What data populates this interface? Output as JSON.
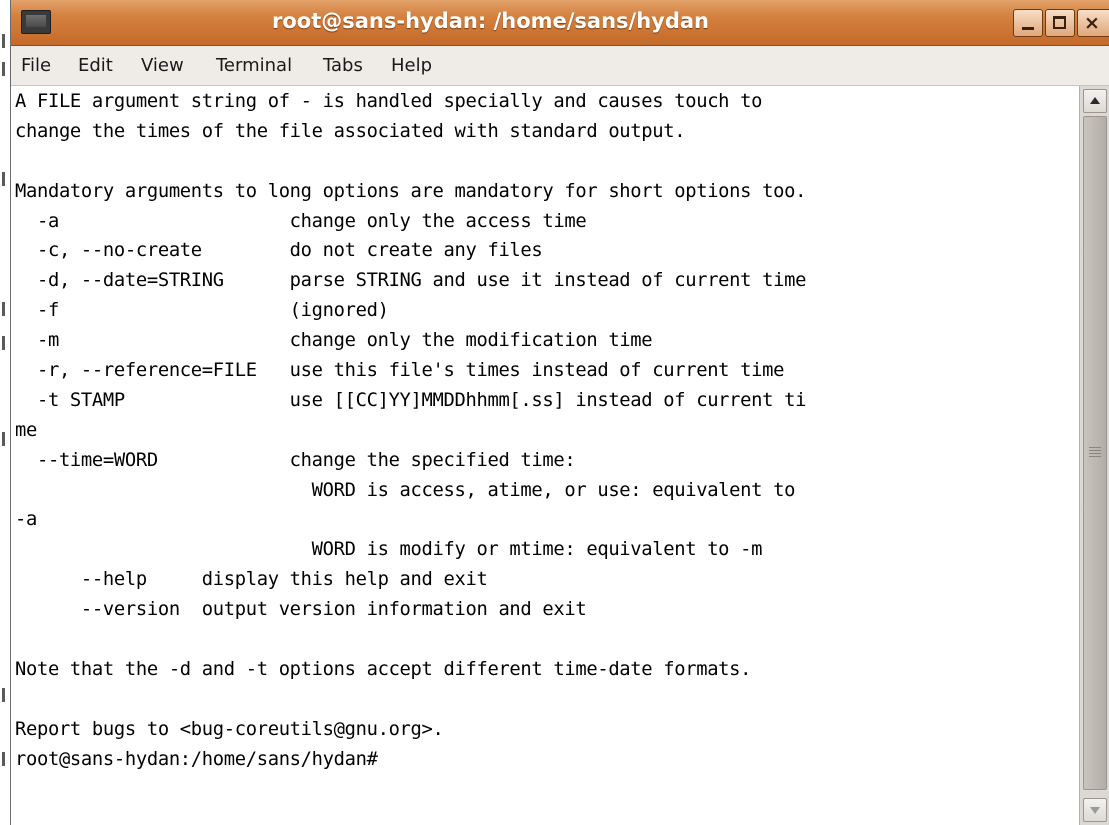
{
  "window": {
    "title": "root@sans-hydan: /home/sans/hydan",
    "icon": "terminal-icon"
  },
  "controls": {
    "minimize": "minimize-icon",
    "maximize": "maximize-icon",
    "close": "close-icon",
    "close_glyph": "×"
  },
  "menu": {
    "items": [
      {
        "label": "File",
        "x": 0
      },
      {
        "label": "Edit"
      },
      {
        "label": "View"
      },
      {
        "label": "Terminal"
      },
      {
        "label": "Tabs"
      },
      {
        "label": "Help"
      }
    ]
  },
  "terminal": {
    "lines": [
      "A FILE argument string of - is handled specially and causes touch to",
      "change the times of the file associated with standard output.",
      "",
      "Mandatory arguments to long options are mandatory for short options too.",
      "  -a                     change only the access time",
      "  -c, --no-create        do not create any files",
      "  -d, --date=STRING      parse STRING and use it instead of current time",
      "  -f                     (ignored)",
      "  -m                     change only the modification time",
      "  -r, --reference=FILE   use this file's times instead of current time",
      "  -t STAMP               use [[CC]YY]MMDDhhmm[.ss] instead of current ti",
      "me",
      "  --time=WORD            change the specified time:",
      "                           WORD is access, atime, or use: equivalent to",
      "-a",
      "                           WORD is modify or mtime: equivalent to -m",
      "      --help     display this help and exit",
      "      --version  output version information and exit",
      "",
      "Note that the -d and -t options accept different time-date formats.",
      "",
      "Report bugs to <bug-coreutils@gnu.org>.",
      "root@sans-hydan:/home/sans/hydan#"
    ]
  },
  "colors": {
    "titlebar": "#d5813f",
    "menubar": "#efebe7",
    "terminal_bg": "#ffffff",
    "terminal_fg": "#000000"
  }
}
